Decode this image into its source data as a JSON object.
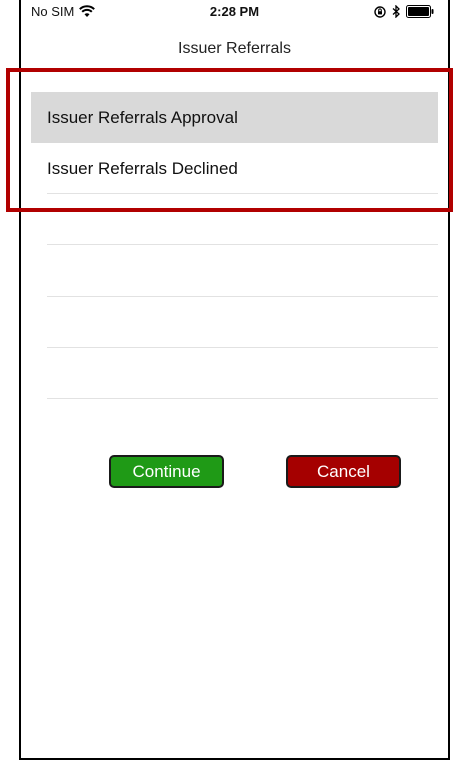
{
  "status_bar": {
    "carrier": "No SIM",
    "time": "2:28 PM"
  },
  "nav": {
    "title": "Issuer Referrals"
  },
  "list": {
    "items": [
      {
        "label": "Issuer Referrals Approval",
        "selected": true
      },
      {
        "label": "Issuer Referrals Declined",
        "selected": false
      }
    ]
  },
  "actions": {
    "continue_label": "Continue",
    "cancel_label": "Cancel"
  },
  "colors": {
    "continue_bg": "#1f9a16",
    "cancel_bg": "#a50000",
    "highlight": "#b10000",
    "selected_row": "#d9d9d9"
  },
  "icons": [
    "wifi-icon",
    "orientation-lock-icon",
    "bluetooth-icon",
    "battery-icon"
  ]
}
